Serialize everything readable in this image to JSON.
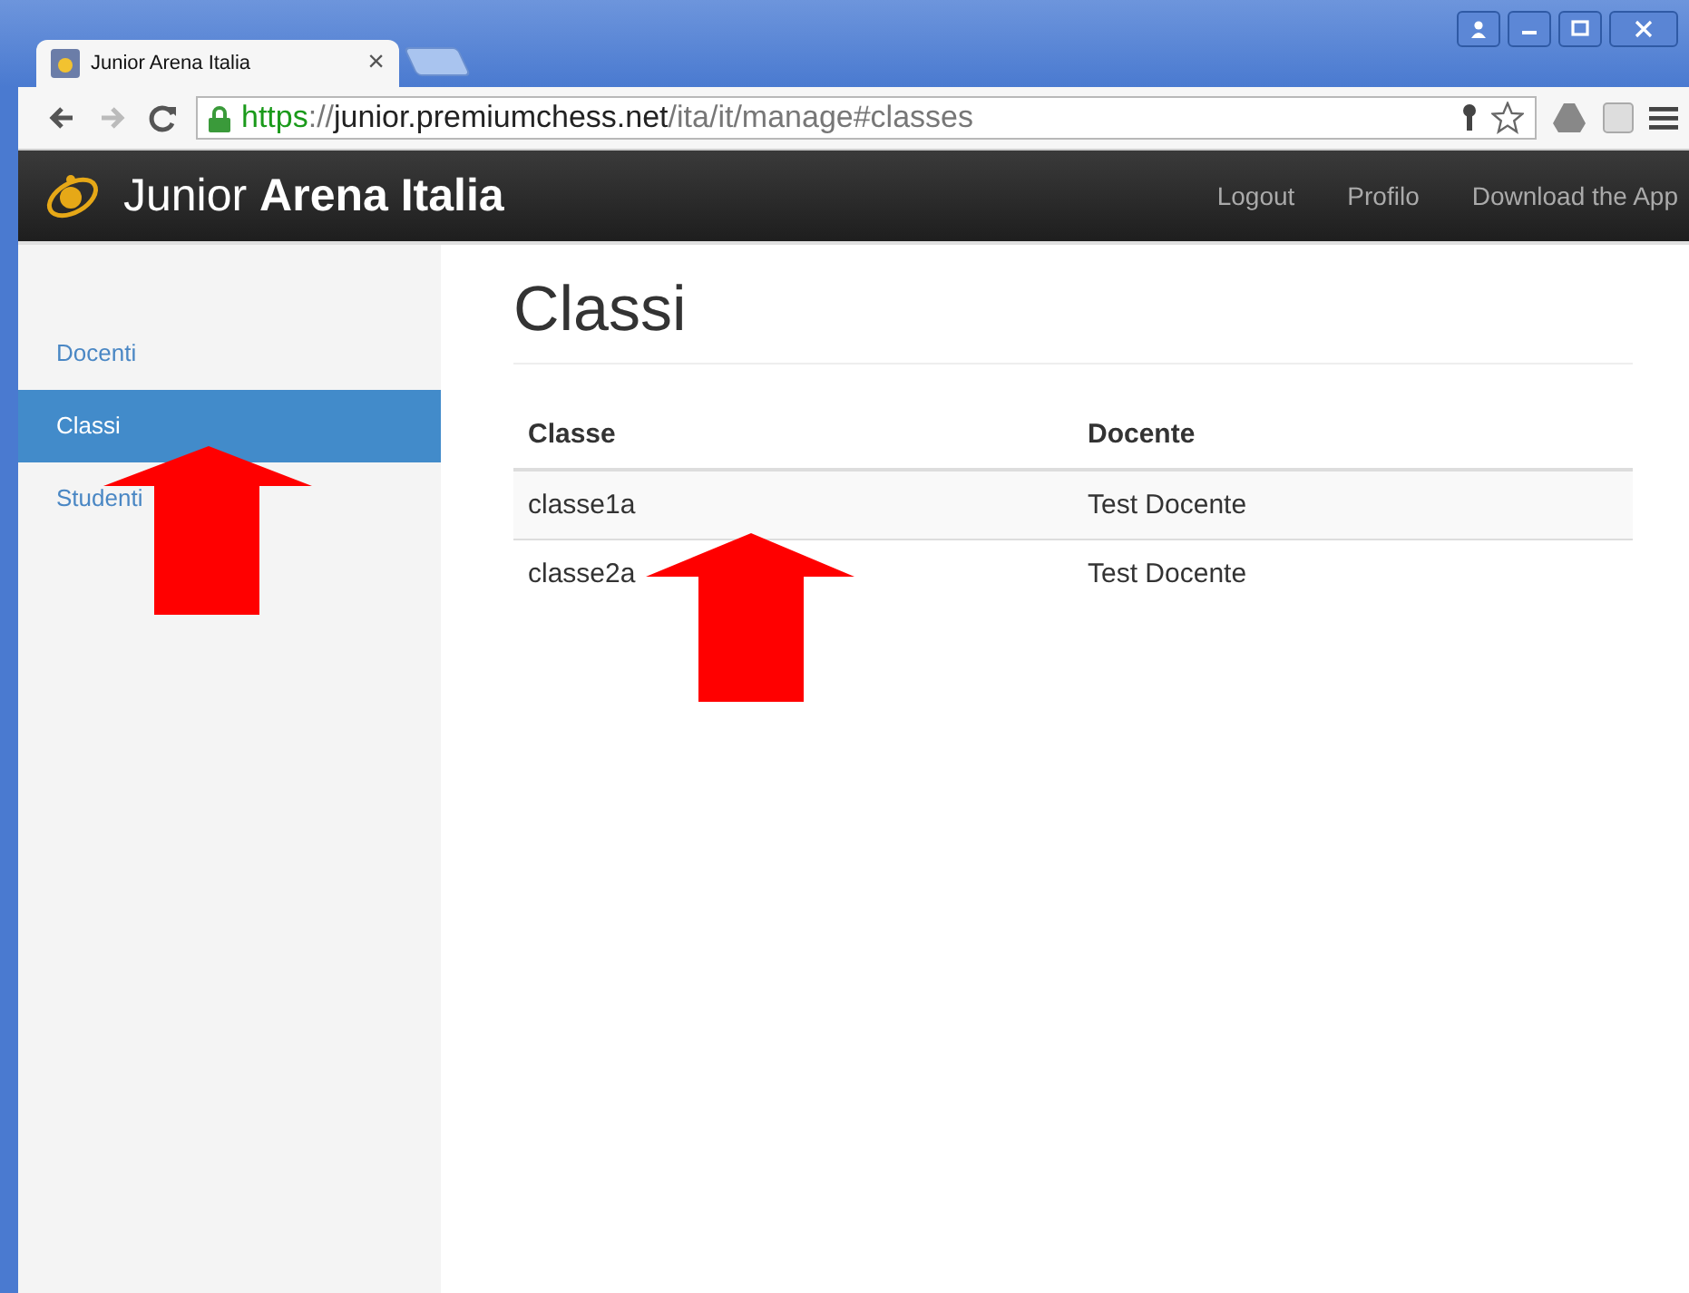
{
  "browser": {
    "tab": {
      "title": "Junior Arena Italia",
      "close": "×"
    },
    "address": [
      {
        "text": "https",
        "kind": "scheme"
      },
      {
        "text": "://",
        "kind": "sep"
      },
      {
        "text": "junior.premiumchess.net",
        "kind": "host"
      },
      {
        "text": "/ita/it/manage#classes",
        "kind": "path"
      }
    ]
  },
  "navbar": {
    "brand": [
      {
        "text": "Junior ",
        "kind": "light"
      },
      {
        "text": "Arena Italia",
        "kind": "bold"
      }
    ],
    "links": [
      "Logout",
      "Profilo",
      "Download the App"
    ]
  },
  "sidebar": {
    "items": [
      {
        "label": "Docenti",
        "selected": false
      },
      {
        "label": "Classi",
        "selected": true
      },
      {
        "label": "Studenti",
        "selected": false
      }
    ]
  },
  "page": {
    "title": "Classi",
    "table": {
      "columns": [
        "Classe",
        "Docente"
      ],
      "rows": [
        [
          "classe1a",
          "Test Docente"
        ],
        [
          "classe2a",
          "Test Docente"
        ]
      ]
    }
  }
}
